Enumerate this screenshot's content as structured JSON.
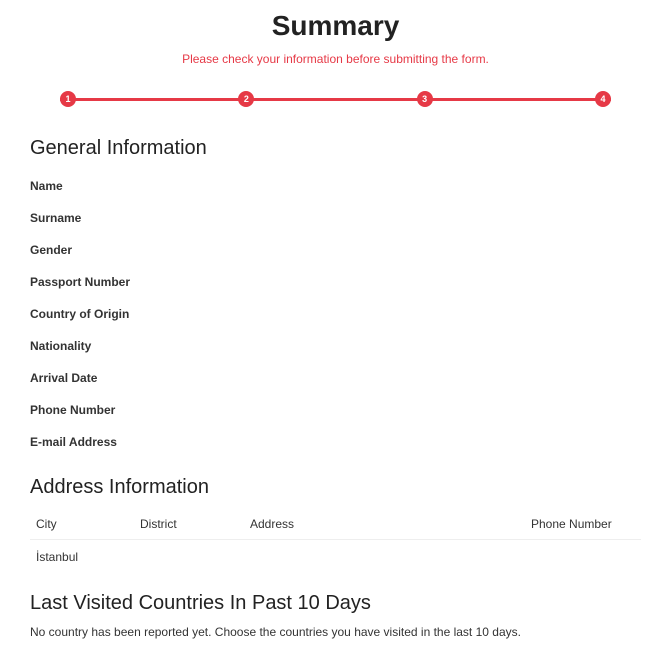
{
  "title": "Summary",
  "subtitle": "Please check your information before submitting the form.",
  "stepper": {
    "steps": [
      "1",
      "2",
      "3",
      "4"
    ]
  },
  "sections": {
    "general": {
      "header": "General Information",
      "fields": {
        "name": "Name",
        "surname": "Surname",
        "gender": "Gender",
        "passport": "Passport Number",
        "origin": "Country of Origin",
        "nationality": "Nationality",
        "arrival": "Arrival Date",
        "phone": "Phone Number",
        "email": "E-mail Address"
      }
    },
    "address": {
      "header": "Address Information",
      "columns": {
        "city": "City",
        "district": "District",
        "address": "Address",
        "phone": "Phone Number"
      },
      "rows": [
        {
          "city": "İstanbul",
          "district": "",
          "address": "",
          "phone": ""
        }
      ]
    },
    "visited": {
      "header": "Last Visited Countries In Past 10 Days",
      "empty_note": "No country has been reported yet. Choose the countries you have visited in the last 10 days."
    }
  }
}
